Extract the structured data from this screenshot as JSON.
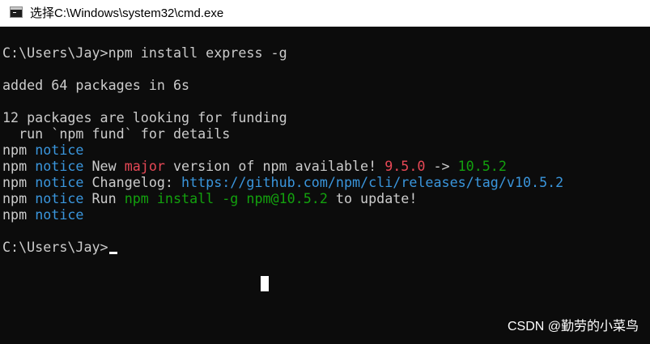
{
  "window": {
    "title": "选择C:\\Windows\\system32\\cmd.exe",
    "icon": "cmd-icon"
  },
  "console": {
    "lines": [
      {
        "segments": [
          {
            "text": "C:\\Users\\Jay>npm install express -g",
            "color": "#cccccc"
          }
        ]
      },
      {
        "segments": [
          {
            "text": "",
            "color": "#cccccc"
          }
        ]
      },
      {
        "segments": [
          {
            "text": "added 64 packages in 6s",
            "color": "#cccccc"
          }
        ]
      },
      {
        "segments": [
          {
            "text": "",
            "color": "#cccccc"
          }
        ]
      },
      {
        "segments": [
          {
            "text": "12 packages are looking for funding",
            "color": "#cccccc"
          }
        ]
      },
      {
        "segments": [
          {
            "text": "  run `npm fund` for details",
            "color": "#cccccc"
          }
        ]
      },
      {
        "segments": [
          {
            "text": "npm ",
            "color": "#cccccc"
          },
          {
            "text": "notice",
            "color": "#3a96dd"
          }
        ]
      },
      {
        "segments": [
          {
            "text": "npm ",
            "color": "#cccccc"
          },
          {
            "text": "notice",
            "color": "#3a96dd"
          },
          {
            "text": " New ",
            "color": "#cccccc"
          },
          {
            "text": "major",
            "color": "#e74856"
          },
          {
            "text": " version of npm available! ",
            "color": "#cccccc"
          },
          {
            "text": "9.5.0",
            "color": "#e74856"
          },
          {
            "text": " -> ",
            "color": "#cccccc"
          },
          {
            "text": "10.5.2",
            "color": "#13a10e"
          }
        ]
      },
      {
        "segments": [
          {
            "text": "npm ",
            "color": "#cccccc"
          },
          {
            "text": "notice",
            "color": "#3a96dd"
          },
          {
            "text": " Changelog: ",
            "color": "#cccccc"
          },
          {
            "text": "https://github.com/npm/cli/releases/tag/v10.5.2",
            "color": "#3a96dd"
          }
        ]
      },
      {
        "segments": [
          {
            "text": "npm ",
            "color": "#cccccc"
          },
          {
            "text": "notice",
            "color": "#3a96dd"
          },
          {
            "text": " Run ",
            "color": "#cccccc"
          },
          {
            "text": "npm install -g npm@10.5.2",
            "color": "#13a10e"
          },
          {
            "text": " to update!",
            "color": "#cccccc"
          }
        ]
      },
      {
        "segments": [
          {
            "text": "npm ",
            "color": "#cccccc"
          },
          {
            "text": "notice",
            "color": "#3a96dd"
          }
        ]
      },
      {
        "segments": [
          {
            "text": "",
            "color": "#cccccc"
          }
        ]
      },
      {
        "segments": [
          {
            "text": "C:\\Users\\Jay>",
            "color": "#cccccc"
          }
        ],
        "cursor": true
      }
    ]
  },
  "watermark": "CSDN @勤劳的小菜鸟"
}
